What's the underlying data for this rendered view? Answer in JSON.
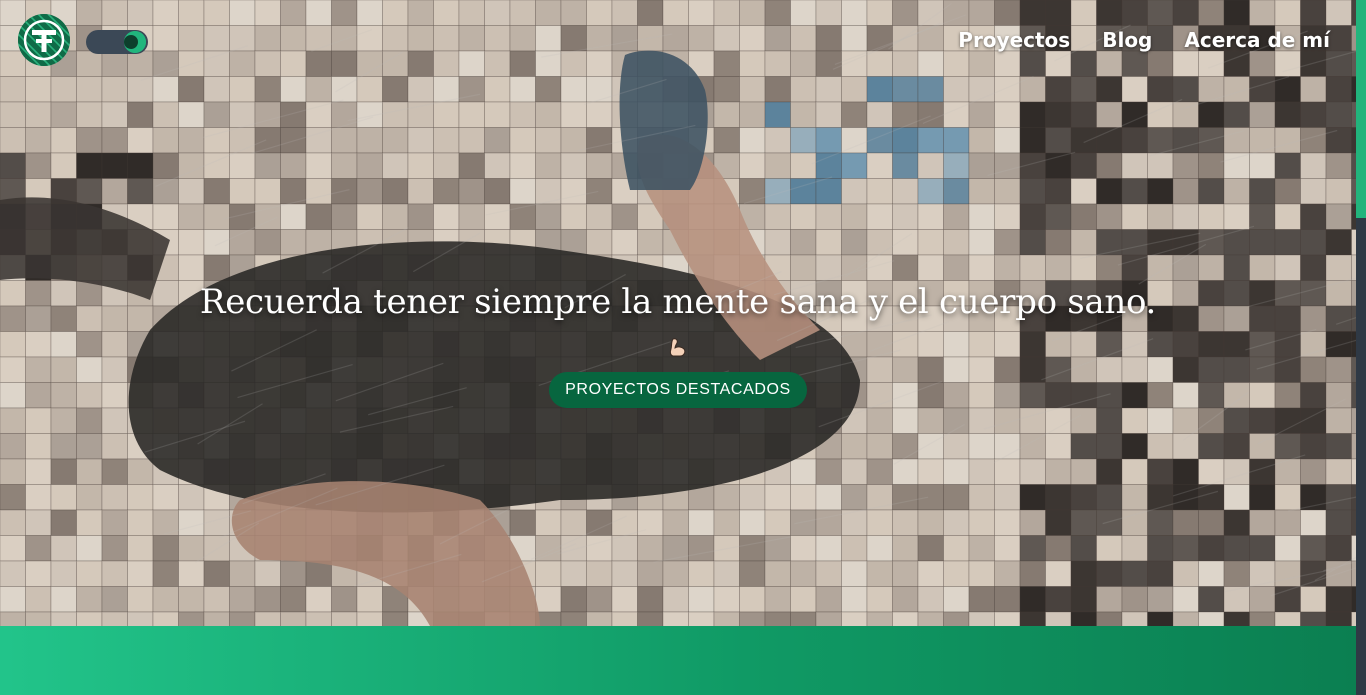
{
  "nav": {
    "logo_icon": "tf-monogram-logo",
    "theme_toggle_icon": "moon-toggle-icon",
    "links": [
      {
        "label": "Proyectos"
      },
      {
        "label": "Blog"
      },
      {
        "label": "Acerca de mí"
      }
    ]
  },
  "hero": {
    "headline": "Recuerda tener siempre la mente sana y el cuerpo sano.",
    "emoji_icon": "flexed-biceps-icon",
    "cta_label": "PROYECTOS DESTACADOS"
  },
  "colors": {
    "accent": "#21b67d",
    "cta": "#07663f",
    "band_start": "#22c48a",
    "band_end": "#0b7f51",
    "scrollbar_track": "#2f3945"
  }
}
